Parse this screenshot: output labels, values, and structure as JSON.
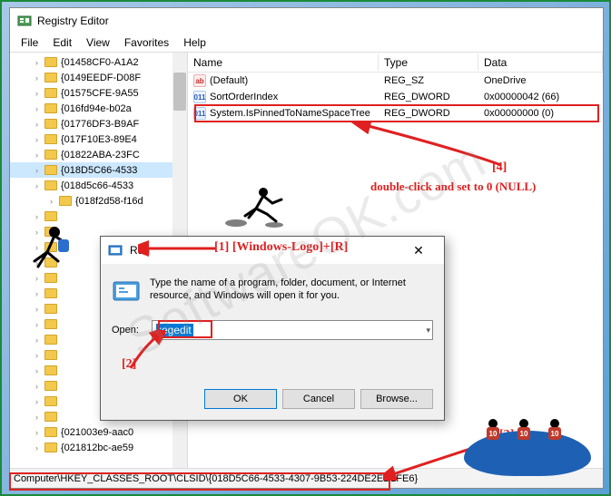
{
  "app": {
    "title": "Registry Editor",
    "menu": [
      "File",
      "Edit",
      "View",
      "Favorites",
      "Help"
    ]
  },
  "tree": {
    "items": [
      "{01458CF0-A1A2",
      "{0149EEDF-D08F",
      "{01575CFE-9A55",
      "{016fd94e-b02a",
      "{01776DF3-B9AF",
      "{017F10E3-89E4",
      "{01822ABA-23FC",
      "{018D5C66-4533",
      "{018d5c66-4533",
      "{018f2d58-f16d",
      "",
      "",
      "",
      "",
      "",
      "",
      "",
      "",
      "",
      "",
      "",
      "",
      "",
      "",
      "{021003e9-aac0",
      "{021812bc-ae59"
    ],
    "selected_index": 7
  },
  "list": {
    "headers": {
      "name": "Name",
      "type": "Type",
      "data": "Data"
    },
    "rows": [
      {
        "icon": "sz",
        "name": "(Default)",
        "type": "REG_SZ",
        "data": "OneDrive"
      },
      {
        "icon": "dw",
        "name": "SortOrderIndex",
        "type": "REG_DWORD",
        "data": "0x00000042 (66)"
      },
      {
        "icon": "dw",
        "name": "System.IsPinnedToNameSpaceTree",
        "type": "REG_DWORD",
        "data": "0x00000000 (0)"
      }
    ]
  },
  "statusbar": {
    "path": "Computer\\HKEY_CLASSES_ROOT\\CLSID\\{018D5C66-4533-4307-9B53-224DE2ED1FE6}"
  },
  "run": {
    "title": "Run",
    "desc": "Type the name of a program, folder, document, or Internet resource, and Windows will open it for you.",
    "open_label": "Open:",
    "value": "regedit",
    "ok": "OK",
    "cancel": "Cancel",
    "browse": "Browse..."
  },
  "annotations": {
    "a1": "[1] [Windows-Logo]+[R]",
    "a2": "[2]",
    "a3": "[3]",
    "a4": "[4]",
    "a4b": "double-click and set to 0 (NULL)"
  },
  "watermark": "SoftwareOK.com",
  "diver_num": "10"
}
